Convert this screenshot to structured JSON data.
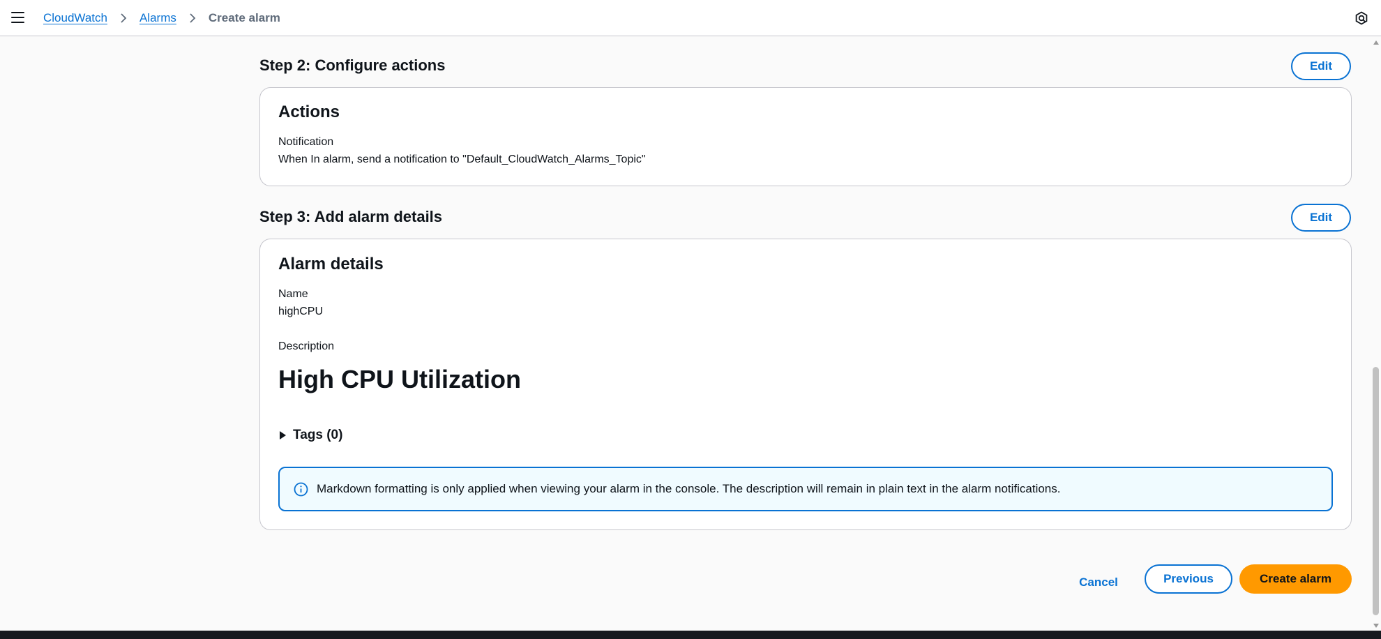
{
  "header": {
    "breadcrumbs": [
      "CloudWatch",
      "Alarms",
      "Create alarm"
    ]
  },
  "step2": {
    "title": "Step 2: Configure actions",
    "edit_label": "Edit",
    "card_title": "Actions",
    "notification_label": "Notification",
    "notification_value": "When In alarm, send a notification to \"Default_CloudWatch_Alarms_Topic\""
  },
  "step3": {
    "title": "Step 3: Add alarm details",
    "edit_label": "Edit",
    "card_title": "Alarm details",
    "name_label": "Name",
    "name_value": "highCPU",
    "description_label": "Description",
    "description_value": "High CPU Utilization",
    "tags_label": "Tags (0)",
    "info_text": "Markdown formatting is only applied when viewing your alarm in the console. The description will remain in plain text in the alarm notifications."
  },
  "footer": {
    "cancel_label": "Cancel",
    "previous_label": "Previous",
    "create_label": "Create alarm"
  },
  "colors": {
    "link": "#0972d3",
    "primary_button": "#ff9900",
    "info_bg": "#f0fbff"
  },
  "icons": [
    "menu-icon",
    "chevron-right-icon",
    "help-icon",
    "caret-right-icon",
    "info-icon"
  ]
}
